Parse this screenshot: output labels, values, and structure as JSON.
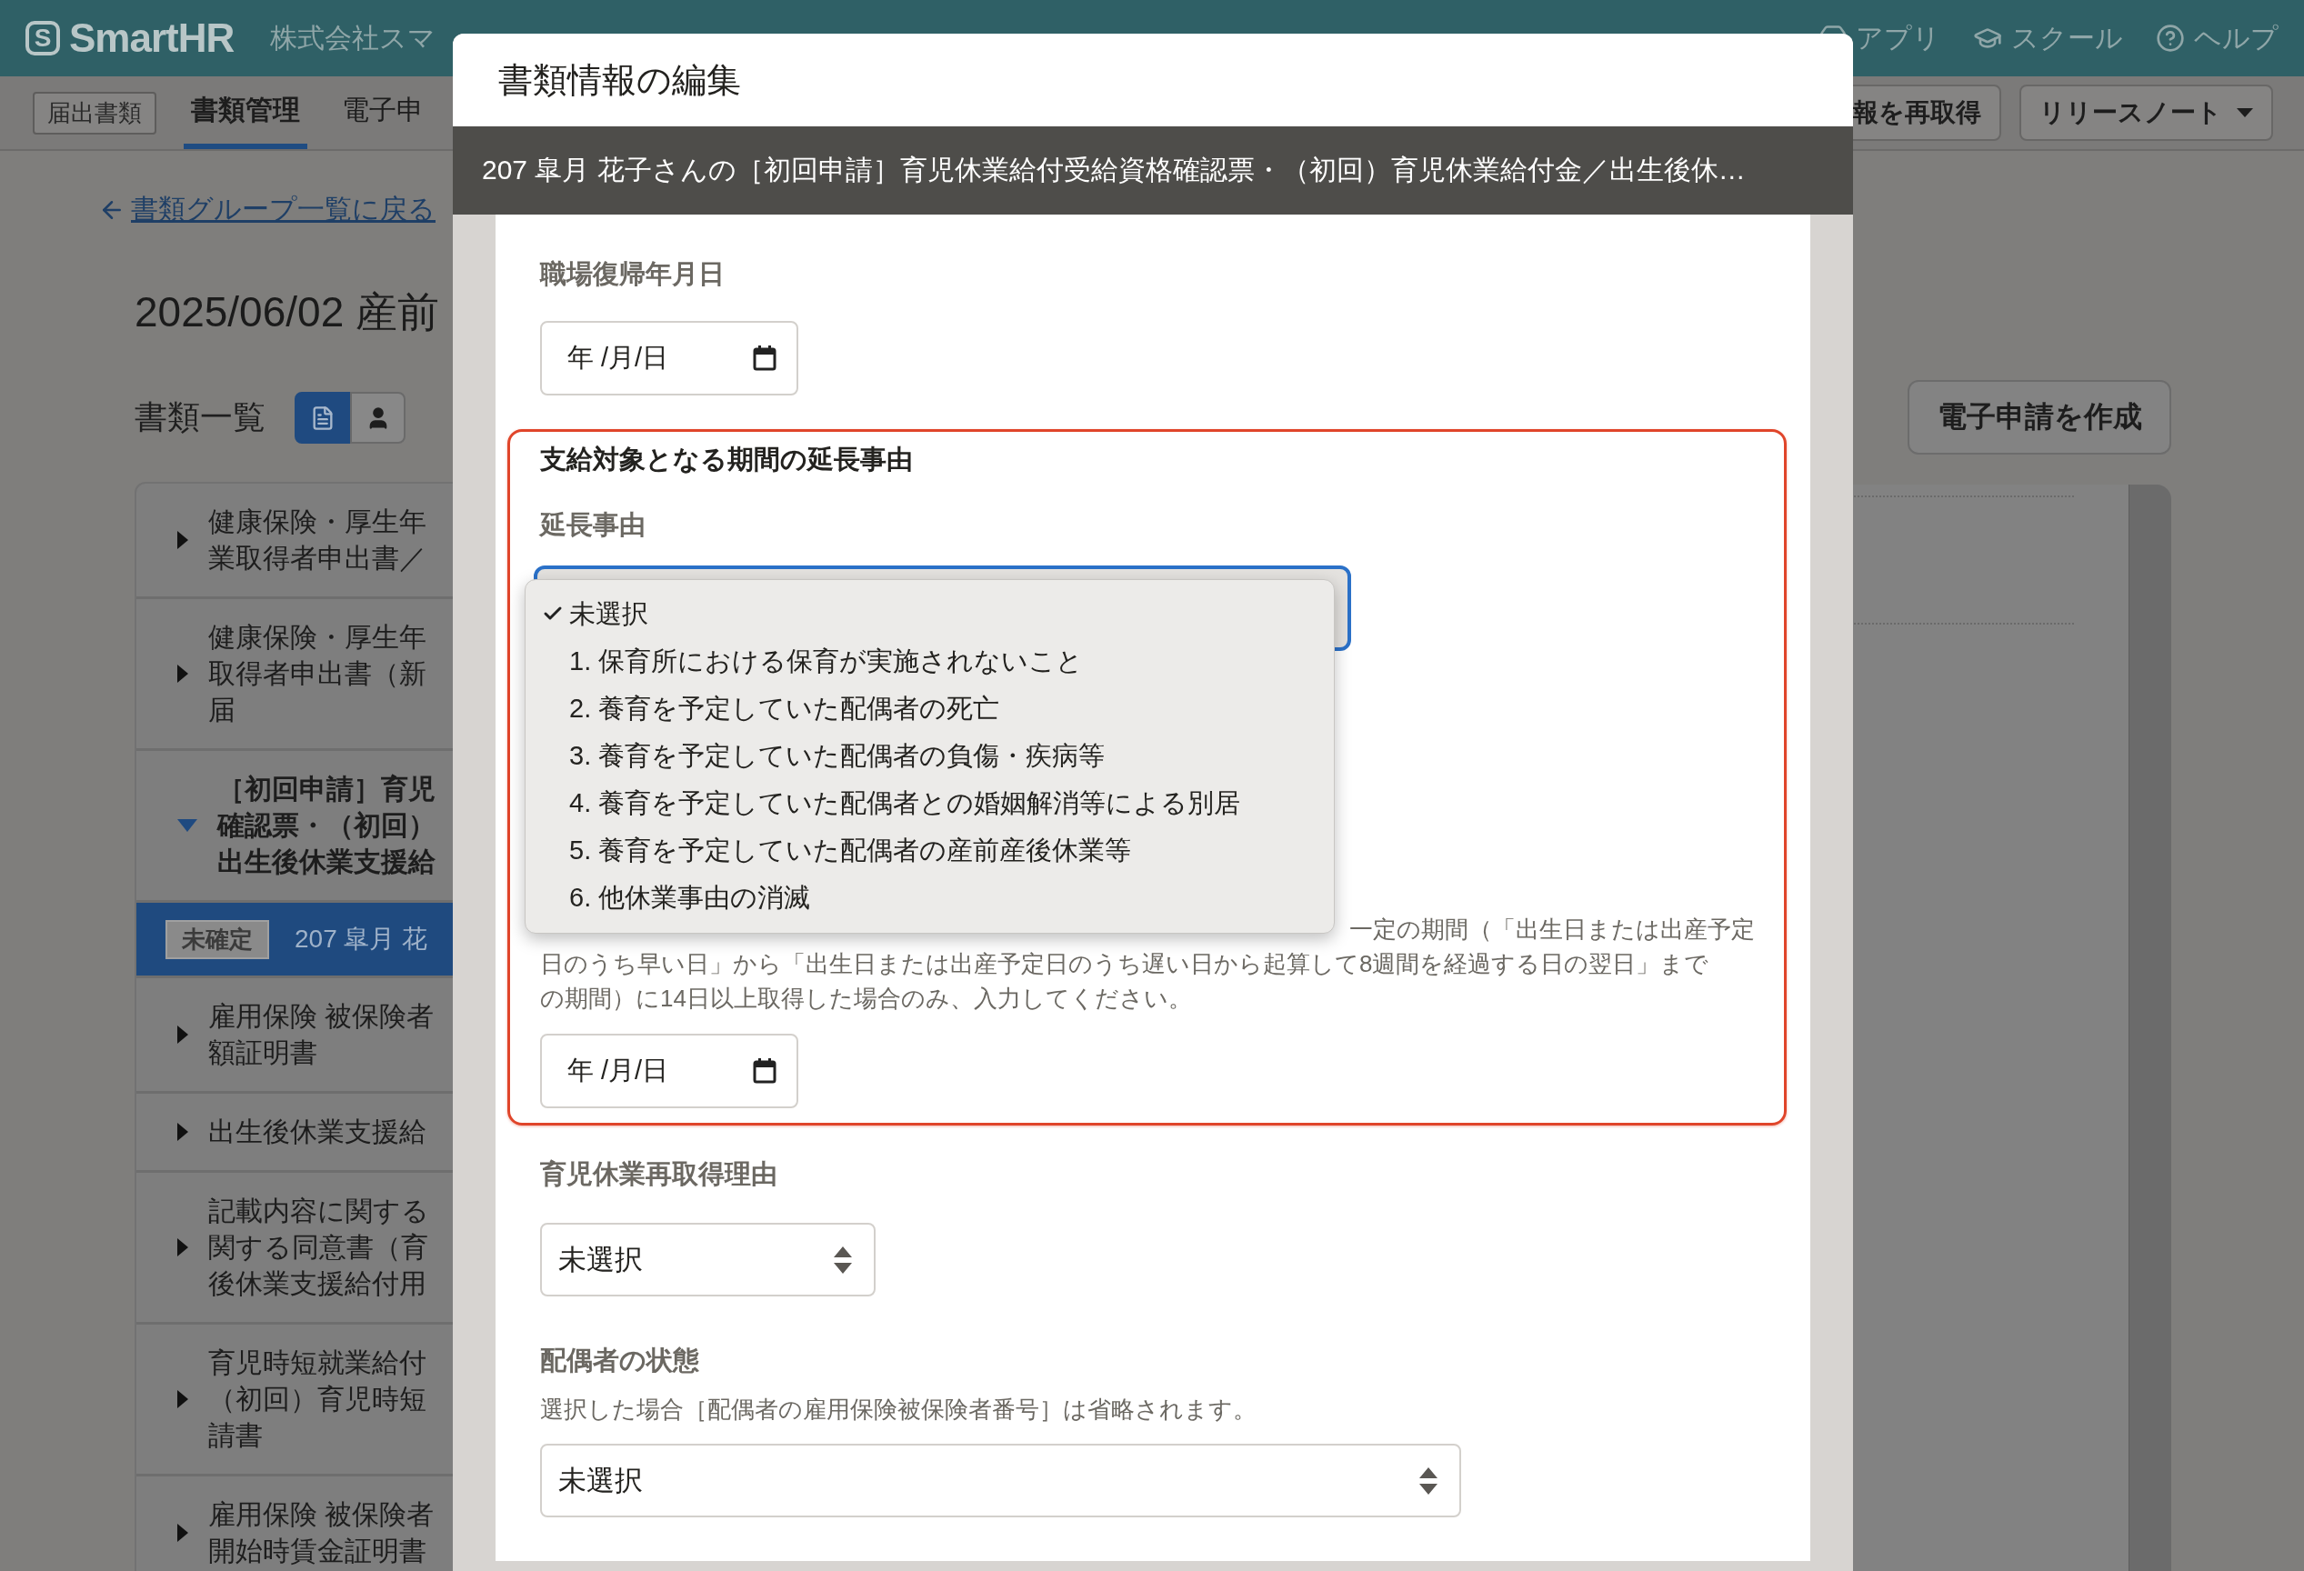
{
  "header": {
    "logo_mark": "S",
    "logo": "SmartHR",
    "company": "株式会社スマ",
    "links": [
      {
        "label": "アプリ",
        "kind": "apps"
      },
      {
        "label": "スクール",
        "kind": "school"
      },
      {
        "label": "ヘルプ",
        "kind": "help"
      }
    ]
  },
  "subnav": {
    "tabs": [
      {
        "label": "届出書類",
        "kind": "boxed",
        "selected": false
      },
      {
        "label": "書類管理",
        "kind": "plain",
        "selected": true
      },
      {
        "label": "電子申",
        "kind": "plain",
        "selected": false
      }
    ],
    "buttons": [
      {
        "label": "報を再取得",
        "kind": "plain"
      },
      {
        "label": "リリースノート",
        "kind": "menu"
      }
    ]
  },
  "page": {
    "back_link": "書類グループ一覧に戻る",
    "title": "2025/06/02 産前",
    "list_title": "書類一覧",
    "view_toggle": [
      {
        "kind": "document",
        "selected": true
      },
      {
        "kind": "person",
        "selected": false
      }
    ],
    "create_button": "電子申請を作成",
    "documents": [
      {
        "lines": [
          "健康保険・厚生年",
          "業取得者申出書／"
        ],
        "expanded": false
      },
      {
        "lines": [
          "健康保険・厚生年",
          "取得者申出書（新",
          "届"
        ],
        "expanded": false
      },
      {
        "lines": [
          "［初回申請］育児",
          "確認票・（初回）",
          "出生後休業支援給"
        ],
        "expanded": true,
        "children": [
          {
            "status": "未確定",
            "name": "207 皐月 花",
            "selected": true
          }
        ]
      },
      {
        "lines": [
          "雇用保険 被保険者",
          "額証明書"
        ],
        "expanded": false
      },
      {
        "lines": [
          "出生後休業支援給"
        ],
        "expanded": false
      },
      {
        "lines": [
          "記載内容に関する",
          "関する同意書（育",
          "後休業支援給付用"
        ],
        "expanded": false
      },
      {
        "lines": [
          "育児時短就業給付",
          "（初回）育児時短",
          "請書"
        ],
        "expanded": false
      },
      {
        "lines": [
          "雇用保険 被保険者",
          "開始時賃金証明書"
        ],
        "expanded": false
      }
    ]
  },
  "modal": {
    "title": "書類情報の編集",
    "banner": "207 皐月 花子さんの［初回申請］育児休業給付受給資格確認票・（初回）育児休業給付金／出生後休…",
    "fields": [
      {
        "kind": "date",
        "label": "職場復帰年月日",
        "placeholder": "年 /月/日"
      },
      {
        "kind": "group",
        "heading": "支給対象となる期間の延長事由",
        "error": true,
        "fields": [
          {
            "kind": "dropdown",
            "label": "延長事由",
            "focused": true,
            "options": [
              {
                "label": "未選択",
                "selected": true
              },
              {
                "label": "1. 保育所における保育が実施されないこと",
                "selected": false
              },
              {
                "label": "2. 養育を予定していた配偶者の死亡",
                "selected": false
              },
              {
                "label": "3. 養育を予定していた配偶者の負傷・疾病等",
                "selected": false
              },
              {
                "label": "4. 養育を予定していた配偶者との婚姻解消等による別居",
                "selected": false
              },
              {
                "label": "5. 養育を予定していた配偶者の産前産後休業等",
                "selected": false
              },
              {
                "label": "6. 他休業事由の消滅",
                "selected": false
              }
            ]
          },
          {
            "kind": "date",
            "help_fragment": "一定の期間（「出生日または出産予定",
            "help_lines": [
              "日のうち早い日」から「出生日または出産予定日のうち遅い日から起算して8週間を経過する日の翌日」まで",
              "の期間）に14日以上取得した場合のみ、入力してください。"
            ],
            "placeholder": "年 /月/日"
          }
        ]
      },
      {
        "kind": "select",
        "label": "育児休業再取得理由",
        "value": "未選択"
      },
      {
        "kind": "select",
        "label": "配偶者の状態",
        "help": "選択した場合［配偶者の雇用保険被保険者番号］は省略されます。",
        "value": "未選択"
      }
    ]
  }
}
